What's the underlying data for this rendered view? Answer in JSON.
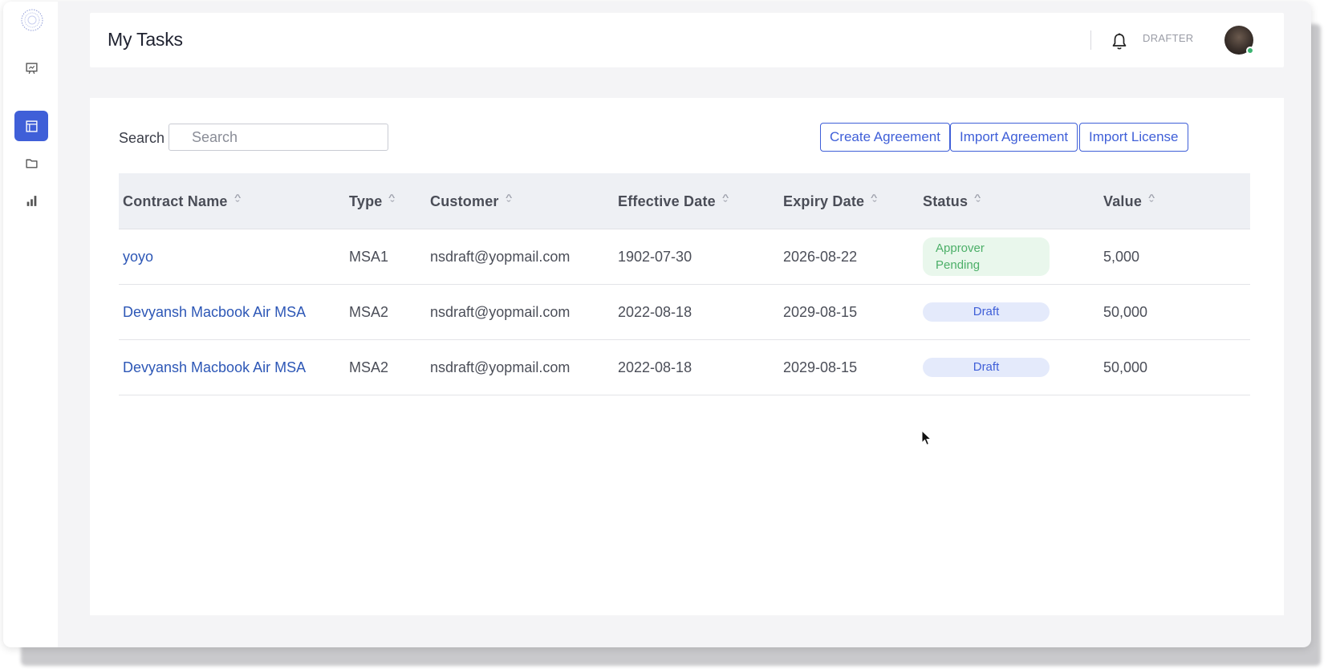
{
  "header": {
    "title": "My Tasks",
    "role": "DRAFTER"
  },
  "sidebar": {
    "items": [
      {
        "icon": "presentation-icon",
        "active": false
      },
      {
        "icon": "document-list-icon",
        "active": true
      },
      {
        "icon": "folder-icon",
        "active": false
      },
      {
        "icon": "bar-chart-icon",
        "active": false
      }
    ]
  },
  "search": {
    "label": "Search",
    "placeholder": "Search",
    "value": ""
  },
  "actions": {
    "create": "Create Agreement",
    "import_agreement": "Import Agreement",
    "import_license": "Import License"
  },
  "table": {
    "columns": [
      "Contract Name",
      "Type",
      "Customer",
      "Effective Date",
      "Expiry Date",
      "Status",
      "Value"
    ],
    "rows": [
      {
        "name": "yoyo",
        "type": "MSA1",
        "customer": "nsdraft@yopmail.com",
        "effective": "1902-07-30",
        "expiry": "2026-08-22",
        "status_line1": "Approver",
        "status_line2": "Pending",
        "value": "5,000"
      },
      {
        "name": "Devyansh Macbook Air MSA",
        "type": "MSA2",
        "customer": "nsdraft@yopmail.com",
        "effective": "2022-08-18",
        "expiry": "2029-08-15",
        "status": "Draft",
        "value": "50,000"
      },
      {
        "name": "Devyansh Macbook Air MSA",
        "type": "MSA2",
        "customer": "nsdraft@yopmail.com",
        "effective": "2022-08-18",
        "expiry": "2029-08-15",
        "status": "Draft",
        "value": "50,000"
      }
    ]
  },
  "colors": {
    "accent": "#3f5fd8",
    "link": "#2d57b6",
    "pending_bg": "#e9f7ec",
    "pending_text": "#4caf68",
    "draft_bg": "#e4eafb"
  }
}
